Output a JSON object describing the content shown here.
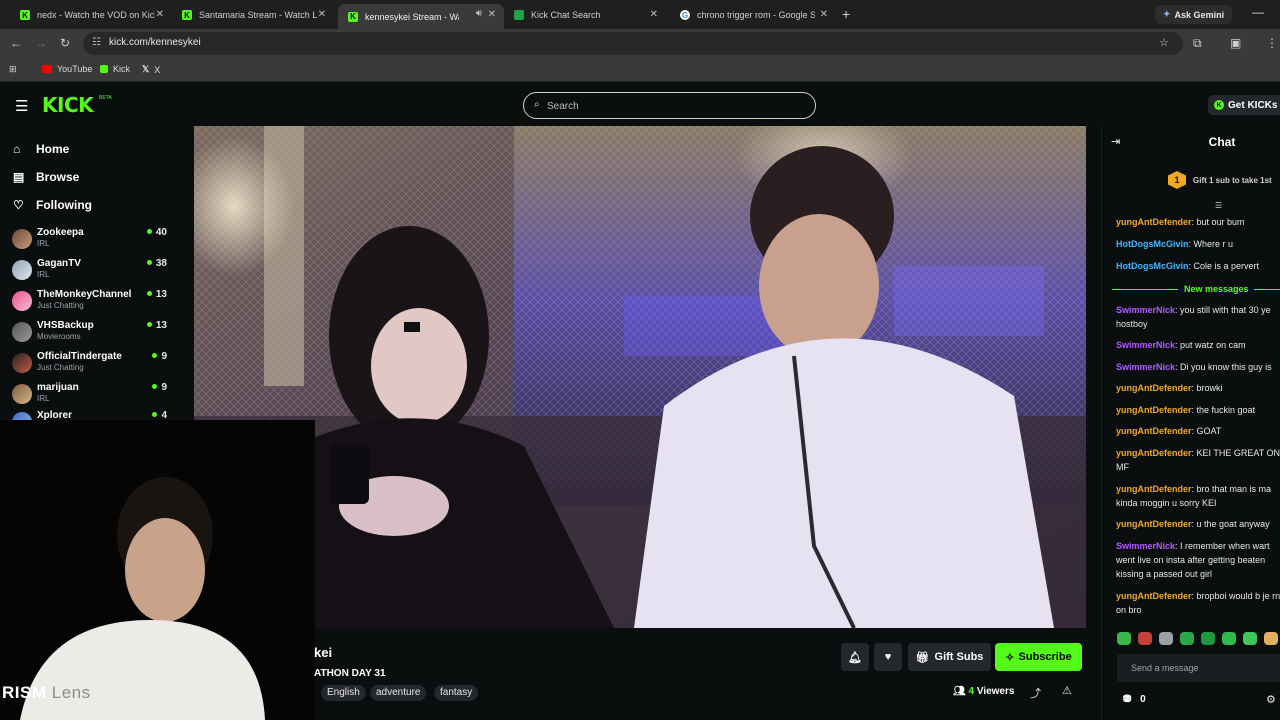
{
  "browser": {
    "tabs": [
      {
        "title": "nedx - Watch the VOD on Kick",
        "favicon": "kick-icon"
      },
      {
        "title": "Santamaria Stream - Watch Live",
        "favicon": "kick-icon"
      },
      {
        "title": "kennesykei Stream - Watch Live",
        "favicon": "kick-icon",
        "active": true
      },
      {
        "title": "Kick Chat Search",
        "favicon": "chat-search-icon"
      },
      {
        "title": "chrono trigger rom - Google Search",
        "favicon": "google-icon"
      }
    ],
    "gemini_label": "Ask Gemini",
    "url": "kick.com/kennesykei",
    "bookmarks": [
      "YouTube",
      "Kick",
      "X"
    ]
  },
  "header": {
    "logo": "KICK",
    "beta": "BETA",
    "search_placeholder": "Search",
    "get_kicks": "Get KICKs"
  },
  "sidebar": {
    "nav": [
      {
        "label": "Home",
        "icon": "home-icon"
      },
      {
        "label": "Browse",
        "icon": "browse-icon"
      },
      {
        "label": "Following",
        "icon": "heart-icon"
      }
    ],
    "channels": [
      {
        "name": "Zookeepa",
        "category": "IRL",
        "viewers": "40"
      },
      {
        "name": "GaganTV",
        "category": "IRL",
        "viewers": "38"
      },
      {
        "name": "TheMonkeyChannel",
        "category": "Just Chatting",
        "viewers": "13"
      },
      {
        "name": "VHSBackup",
        "category": "Movierooms",
        "viewers": "13"
      },
      {
        "name": "OfficialTindergate",
        "category": "Just Chatting",
        "viewers": "9"
      },
      {
        "name": "marijuan",
        "category": "IRL",
        "viewers": "9"
      },
      {
        "name": "Xplorer",
        "category": "",
        "viewers": "4"
      }
    ]
  },
  "stream": {
    "streamer_partial": "kei",
    "title_partial": "ATHON DAY 31",
    "tags": [
      "English",
      "adventure",
      "fantasy"
    ],
    "gift_subs": "Gift Subs",
    "subscribe": "Subscribe",
    "viewers_count": "4",
    "viewers_label": "Viewers"
  },
  "overlay": {
    "text": "RISM",
    "text_faded": "Lens"
  },
  "chat": {
    "title": "Chat",
    "pinned": {
      "badge": "1",
      "text": "Gift 1 sub to take 1st"
    },
    "messages_before": [
      {
        "user": "yungAntDefender",
        "text": "but our bum",
        "color": "#f1a825"
      },
      {
        "user": "HotDogsMcGivin",
        "text": "Where r u",
        "color": "#3fb6ff"
      },
      {
        "user": "HotDogsMcGivin",
        "text": "Cole is a pervert",
        "color": "#3fb6ff"
      }
    ],
    "new_messages_label": "New messages",
    "messages_after": [
      {
        "user": "SwimmerNick",
        "text": "you still with that 30 ye hostboy",
        "color": "#b15cff"
      },
      {
        "user": "SwimmerNick",
        "text": "put watz on cam",
        "color": "#b15cff"
      },
      {
        "user": "SwimmerNick",
        "text": "Di you know this guy is",
        "color": "#b15cff"
      },
      {
        "user": "yungAntDefender",
        "text": "browki",
        "color": "#f1a825"
      },
      {
        "user": "yungAntDefender",
        "text": "the fuckin goat",
        "color": "#f1a825"
      },
      {
        "user": "yungAntDefender",
        "text": "GOAT",
        "color": "#f1a825"
      },
      {
        "user": "yungAntDefender",
        "text": "KEI THE GREAT ON MF",
        "color": "#f1a825"
      },
      {
        "user": "yungAntDefender",
        "text": "bro that man is ma kinda moggin u sorry KEI",
        "color": "#f1a825"
      },
      {
        "user": "yungAntDefender",
        "text": "u the goat anyway",
        "color": "#f1a825"
      },
      {
        "user": "SwimmerNick",
        "text": "I remember when wart went live on insta after getting beaten kissing a passed out girl",
        "color": "#b15cff"
      },
      {
        "user": "yungAntDefender",
        "text": "bropboi would b je rn on bro",
        "color": "#f1a825"
      }
    ],
    "input_placeholder": "Send a message",
    "points": "0"
  },
  "colors": {
    "kick_green": "#53fc18",
    "bg": "#0b0e0f"
  }
}
